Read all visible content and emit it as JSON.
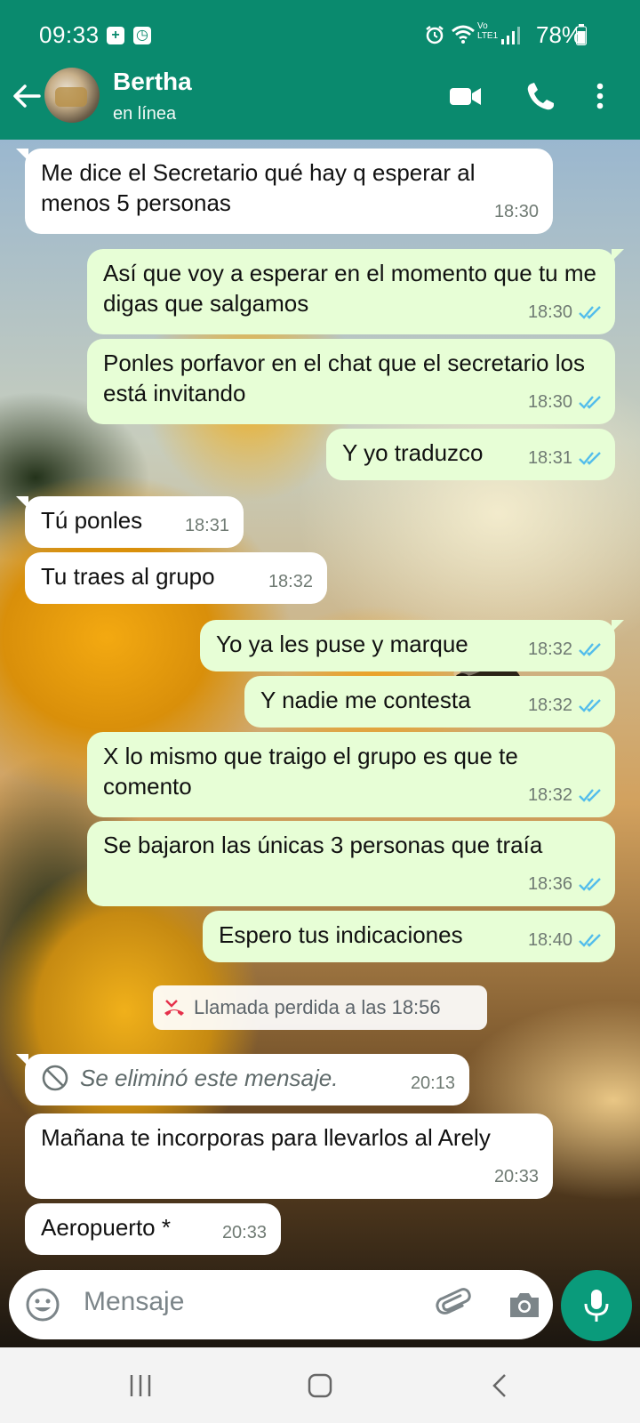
{
  "status_bar": {
    "time": "09:33",
    "battery": "78%",
    "network": "LTE1",
    "carrier_mark": "Vo"
  },
  "header": {
    "contact_name": "Bertha",
    "status": "en línea"
  },
  "messages": [
    {
      "direction": "in",
      "text": "Me dice el Secretario qué hay q esperar al menos 5 personas",
      "time": "18:30"
    },
    {
      "direction": "out",
      "text": "Así que voy a esperar en el momento que tu me digas que salgamos",
      "time": "18:30",
      "read": true
    },
    {
      "direction": "out",
      "text": "Ponles porfavor en el chat que el secretario  los está invitando",
      "time": "18:30",
      "read": true
    },
    {
      "direction": "out",
      "text": "Y yo traduzco",
      "time": "18:31",
      "read": true
    },
    {
      "direction": "in",
      "text": "Tú ponles",
      "time": "18:31"
    },
    {
      "direction": "in",
      "text": "Tu traes al grupo",
      "time": "18:32"
    },
    {
      "direction": "out",
      "text": "Yo ya les puse y marque",
      "time": "18:32",
      "read": true
    },
    {
      "direction": "out",
      "text": "Y nadie me contesta",
      "time": "18:32",
      "read": true
    },
    {
      "direction": "out",
      "text": "X lo mismo que traigo el grupo es que te comento",
      "time": "18:32",
      "read": true
    },
    {
      "direction": "out",
      "text": "Se bajaron las únicas 3 personas que traía",
      "time": "18:36",
      "read": true
    },
    {
      "direction": "out",
      "text": "Espero tus indicaciones",
      "time": "18:40",
      "read": true
    },
    {
      "direction": "in",
      "text": "Se eliminó este mensaje.",
      "time": "20:13",
      "deleted": true
    },
    {
      "direction": "in",
      "text": "Mañana te incorporas para llevarlos al Arely",
      "time": "20:33"
    },
    {
      "direction": "in",
      "text": "Aeropuerto *",
      "time": "20:33"
    }
  ],
  "system_notice": {
    "text": "Llamada perdida a las 18:56"
  },
  "composer": {
    "placeholder": "Mensaje"
  },
  "colors": {
    "header": "#0a8a6e",
    "outgoing_bubble": "#e7fed6",
    "incoming_bubble": "#ffffff",
    "read_ticks": "#53bdeb",
    "mic_button": "#0a9b7b"
  },
  "icons": [
    "back-arrow-icon",
    "video-call-icon",
    "phone-icon",
    "more-vert-icon",
    "emoji-icon",
    "attach-icon",
    "camera-icon",
    "mic-icon",
    "missed-call-icon",
    "blocked-icon",
    "double-check-icon"
  ]
}
